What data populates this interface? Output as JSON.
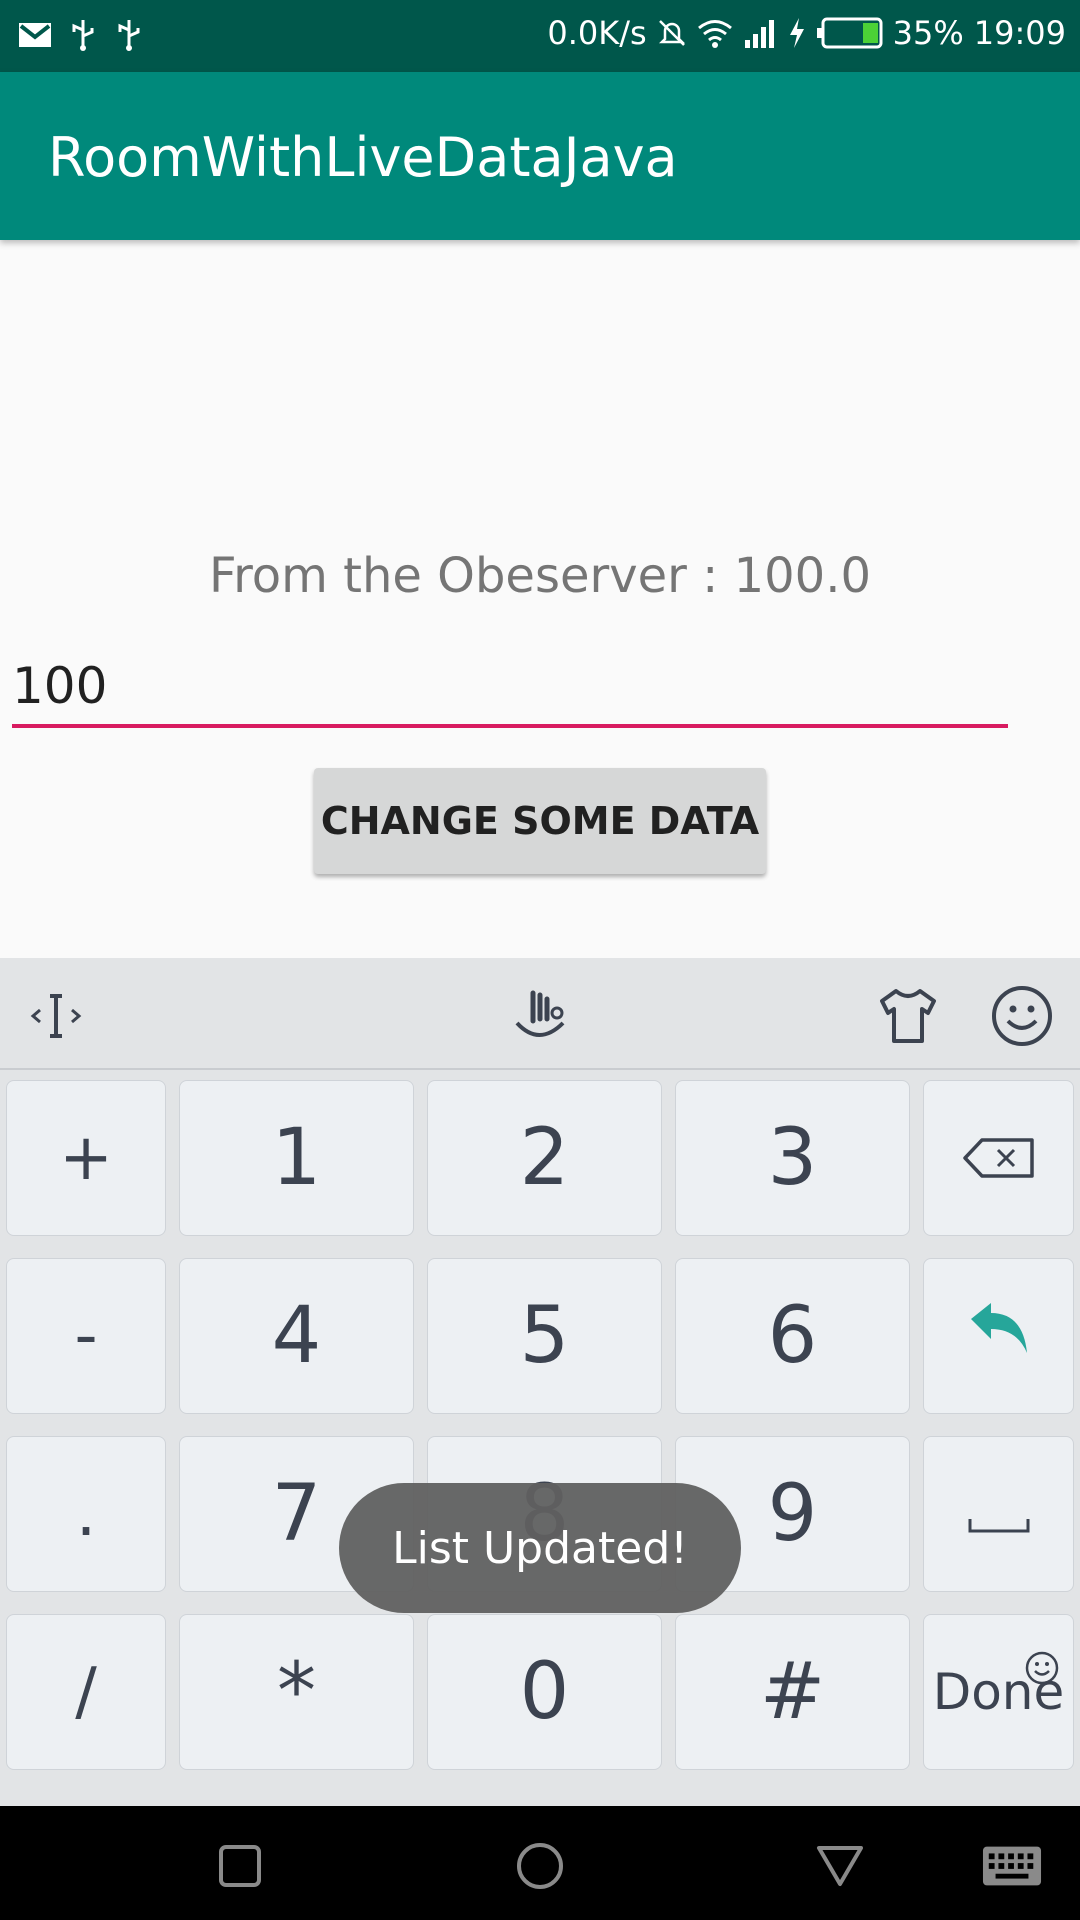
{
  "status_bar": {
    "net_speed": "0.0K/s",
    "battery": "35%",
    "time": "19:09",
    "icons": [
      "gmail-icon",
      "usb-icon",
      "usb-icon",
      "mute-icon",
      "wifi-icon",
      "signal-icon",
      "charging-icon",
      "battery-icon"
    ]
  },
  "app_bar": {
    "title": "RoomWithLiveDataJava"
  },
  "content": {
    "observer_text": "From the Obeserver : 100.0",
    "input_value": "100",
    "button_label": "CHANGE SOME DATA"
  },
  "keyboard": {
    "toolbar": [
      "cursor-icon",
      "gesture-icon",
      "theme-shirt-icon",
      "emoji-icon"
    ],
    "rows": [
      [
        "+",
        "1",
        "2",
        "3",
        "backspace"
      ],
      [
        "-",
        "4",
        "5",
        "6",
        "enter"
      ],
      [
        ".",
        "7",
        "8",
        "9",
        "space"
      ],
      [
        "/",
        "*",
        "0",
        "#",
        "Done"
      ]
    ]
  },
  "toast": {
    "text": "List Updated!"
  },
  "nav_bar": {
    "buttons": [
      "recent-apps-icon",
      "home-icon",
      "back-icon",
      "keyboard-icon"
    ]
  },
  "colors": {
    "status_bar": "#00574b",
    "app_bar": "#00897b",
    "accent": "#d81b60",
    "enter_key": "#26a69a"
  }
}
